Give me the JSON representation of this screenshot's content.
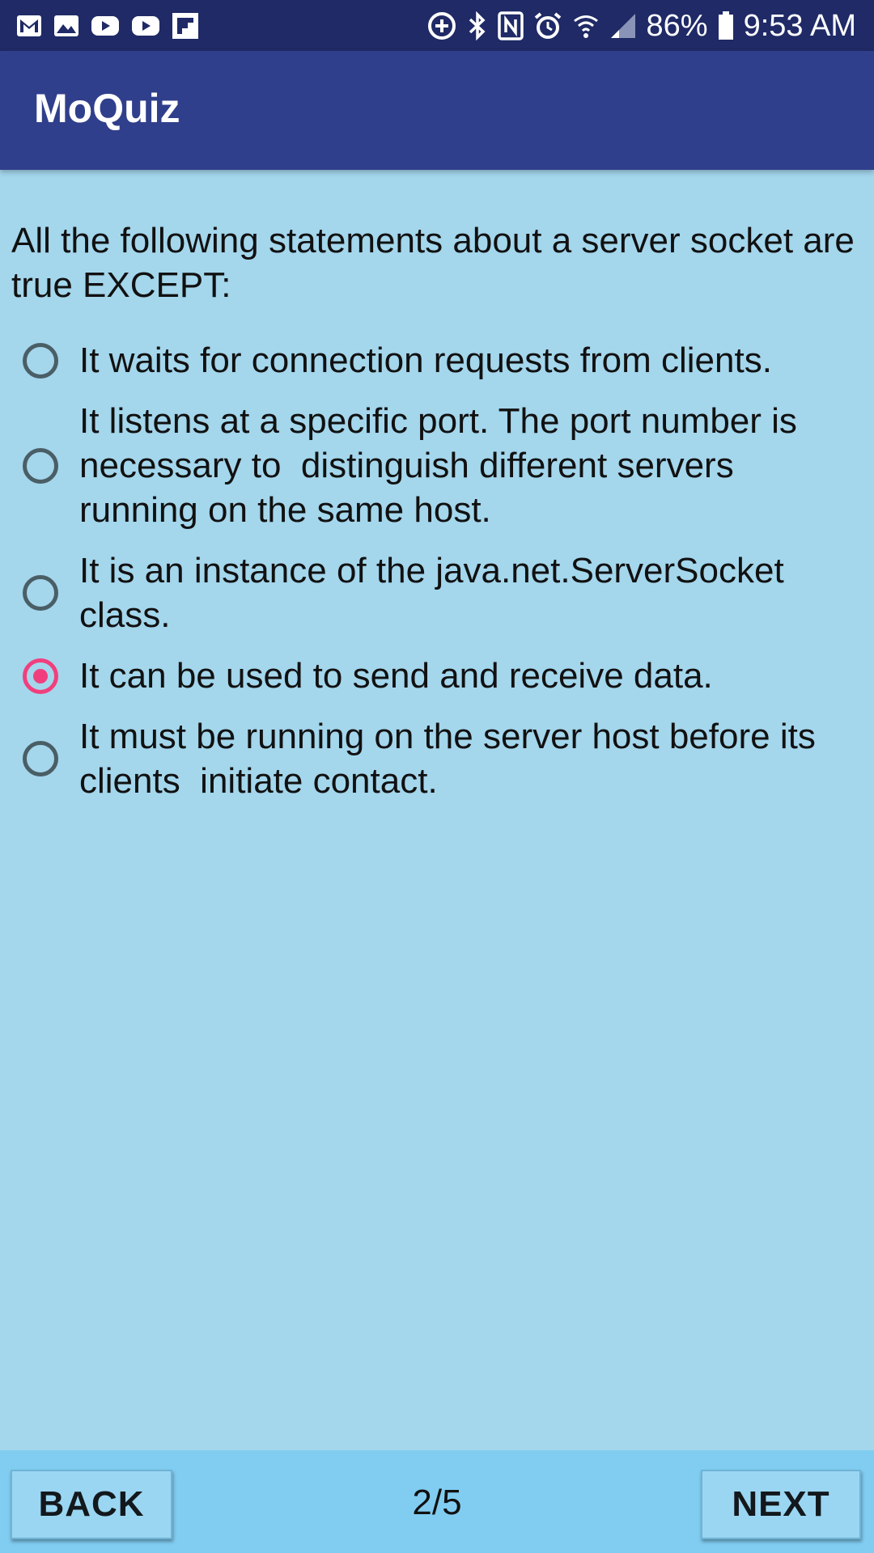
{
  "status_bar": {
    "left_icons": [
      "gmail-icon",
      "gallery-icon",
      "youtube-icon",
      "youtube-icon",
      "flipboard-icon"
    ],
    "right_icons": [
      "data-saver-icon",
      "bluetooth-icon",
      "nfc-icon",
      "alarm-icon",
      "wifi-icon",
      "signal-icon"
    ],
    "battery": "86%",
    "time": "9:53 AM"
  },
  "app_bar": {
    "title": "MoQuiz"
  },
  "question": {
    "text": "All the following statements about a server socket are true EXCEPT:"
  },
  "options": [
    {
      "label": "It waits for connection requests from clients.",
      "selected": false
    },
    {
      "label": "It listens at a specific port. The port number is necessary to  distinguish different servers running on the same host.",
      "selected": false
    },
    {
      "label": "It is an instance of the java.net.ServerSocket class.",
      "selected": false
    },
    {
      "label": "It can be used to send and receive data.",
      "selected": true
    },
    {
      "label": "It must be running on the server host before its clients  initiate contact.",
      "selected": false
    }
  ],
  "footer": {
    "back_label": "BACK",
    "page": "2/5",
    "next_label": "NEXT"
  },
  "colors": {
    "status_bar": "#1f2a66",
    "app_bar": "#303f8c",
    "background": "#a4d6ec",
    "bottom_bar": "#81cdf2",
    "radio_selected": "#f13f7d",
    "radio_unselected": "#4a5e66"
  }
}
